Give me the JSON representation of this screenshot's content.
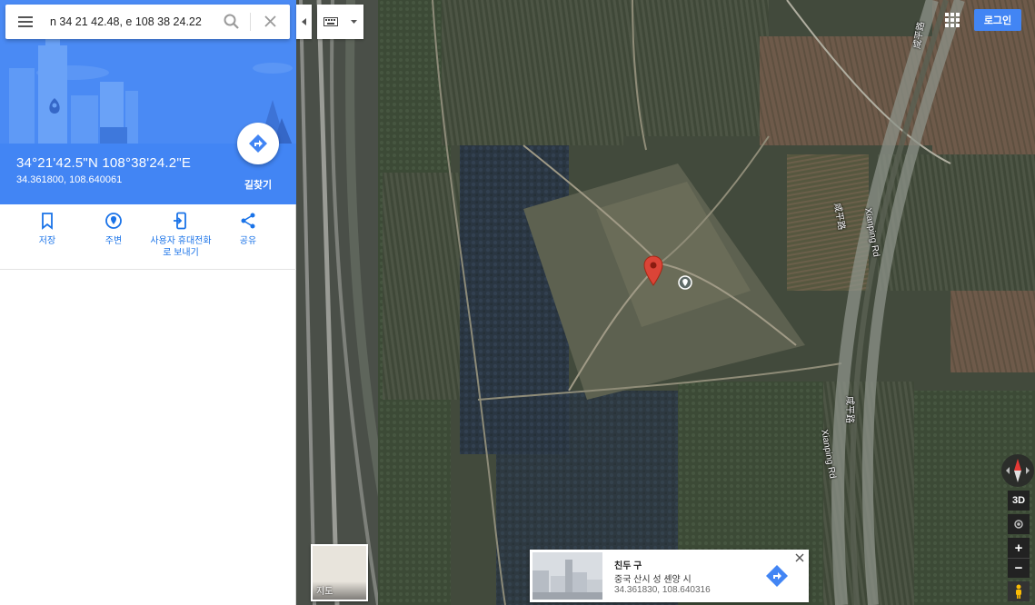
{
  "search": {
    "query": "n 34 21 42.48, e 108 38 24.22",
    "menu_icon": "hamburger-menu-icon",
    "search_icon": "magnifier-icon",
    "clear_icon": "close-icon"
  },
  "place": {
    "coordinates_dms": "34°21'42.5\"N 108°38'24.2\"E",
    "coordinates_decimal": "34.361800, 108.640061",
    "directions_label": "길찾기"
  },
  "actions": [
    {
      "label": "저장",
      "icon": "bookmark-icon"
    },
    {
      "label": "주변",
      "icon": "nearby-pin-icon"
    },
    {
      "label": "사용자 휴대전화\n로 보내기",
      "icon": "send-to-phone-icon"
    },
    {
      "label": "공유",
      "icon": "share-icon"
    }
  ],
  "header": {
    "signin_label": "로그인",
    "apps_icon": "apps-grid-icon"
  },
  "map": {
    "road_labels": [
      "咸平路",
      "Xianping Rd",
      "咸平路",
      "Xianping Rd",
      "咸平路"
    ]
  },
  "controls": {
    "view_3d": "3D",
    "zoom_in": "+",
    "zoom_out": "−"
  },
  "minimap": {
    "label": "지도"
  },
  "card": {
    "title": "친두 구",
    "subtitle": "중국 산시 성 셴양 시",
    "coordinates": "34.361830, 108.640316"
  },
  "colors": {
    "accent": "#4285f4",
    "marker": "#db4437",
    "link": "#1a73e8"
  }
}
